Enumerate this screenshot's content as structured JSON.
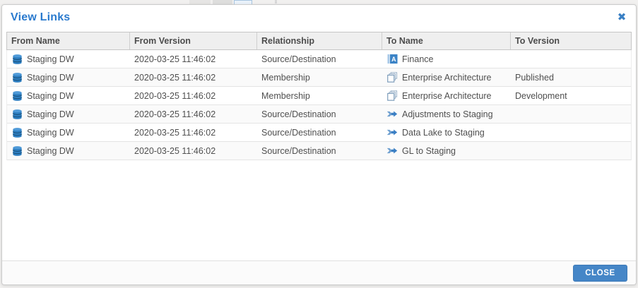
{
  "modal": {
    "title": "View Links",
    "close_icon": "✖",
    "table": {
      "columns": [
        "From Name",
        "From Version",
        "Relationship",
        "To Name",
        "To Version"
      ],
      "rows": [
        {
          "from_icon": "database-icon",
          "from_name": "Staging DW",
          "from_version": "2020-03-25 11:46:02",
          "relationship": "Source/Destination",
          "to_icon": "application-icon",
          "to_name": "Finance",
          "to_version": ""
        },
        {
          "from_icon": "database-icon",
          "from_name": "Staging DW",
          "from_version": "2020-03-25 11:46:02",
          "relationship": "Membership",
          "to_icon": "model-icon",
          "to_name": "Enterprise Architecture",
          "to_version": "Published"
        },
        {
          "from_icon": "database-icon",
          "from_name": "Staging DW",
          "from_version": "2020-03-25 11:46:02",
          "relationship": "Membership",
          "to_icon": "model-icon",
          "to_name": "Enterprise Architecture",
          "to_version": "Development"
        },
        {
          "from_icon": "database-icon",
          "from_name": "Staging DW",
          "from_version": "2020-03-25 11:46:02",
          "relationship": "Source/Destination",
          "to_icon": "mapping-icon",
          "to_name": "Adjustments to Staging",
          "to_version": ""
        },
        {
          "from_icon": "database-icon",
          "from_name": "Staging DW",
          "from_version": "2020-03-25 11:46:02",
          "relationship": "Source/Destination",
          "to_icon": "mapping-icon",
          "to_name": "Data Lake to Staging",
          "to_version": ""
        },
        {
          "from_icon": "database-icon",
          "from_name": "Staging DW",
          "from_version": "2020-03-25 11:46:02",
          "relationship": "Source/Destination",
          "to_icon": "mapping-icon",
          "to_name": "GL to Staging",
          "to_version": ""
        }
      ]
    },
    "footer": {
      "close_label": "CLOSE"
    }
  },
  "colors": {
    "title_blue": "#2a7ace",
    "button_blue": "#4586c7",
    "header_bg": "#efefef",
    "icon_blue": "#3b83c6"
  }
}
